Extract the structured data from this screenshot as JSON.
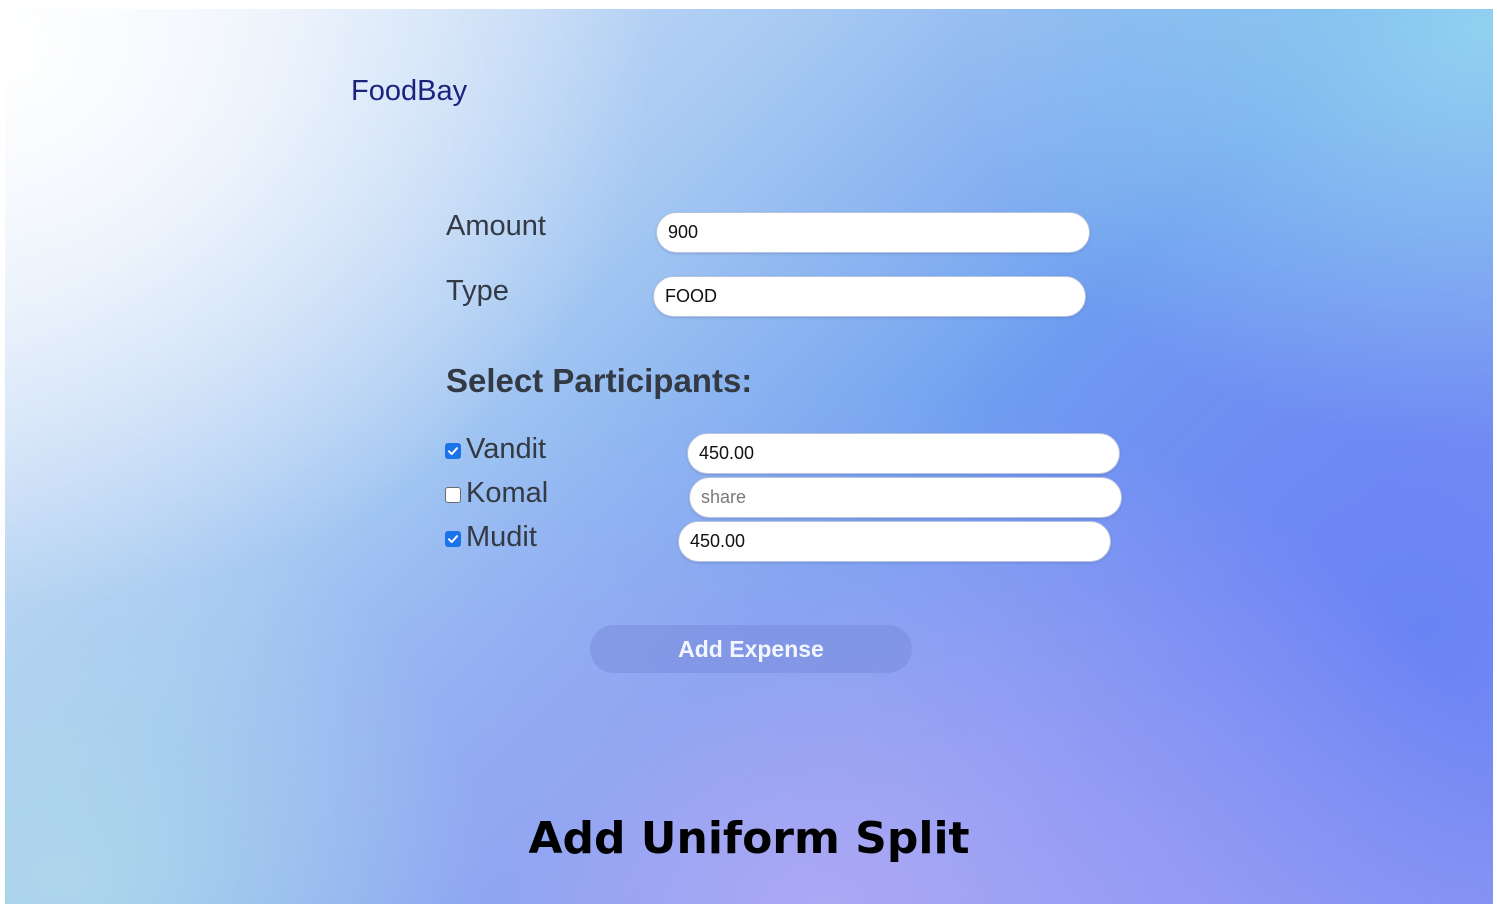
{
  "app": {
    "brand": "FoodBay"
  },
  "form": {
    "amount_label": "Amount",
    "amount_value": "900",
    "type_label": "Type",
    "type_value": "FOOD",
    "participants_title": "Select Participants:",
    "participants": [
      {
        "name": "Vandit",
        "checked": true,
        "share_value": "450.00",
        "share_placeholder": "share"
      },
      {
        "name": "Komal",
        "checked": false,
        "share_value": "",
        "share_placeholder": "share"
      },
      {
        "name": "Mudit",
        "checked": true,
        "share_value": "450.00",
        "share_placeholder": "share"
      }
    ],
    "submit_label": "Add Expense"
  },
  "caption": "Add Uniform Split",
  "colors": {
    "brand_text": "#1a237e",
    "checkbox_checked": "#1a73e8",
    "button_bg": "#8a9be0"
  }
}
